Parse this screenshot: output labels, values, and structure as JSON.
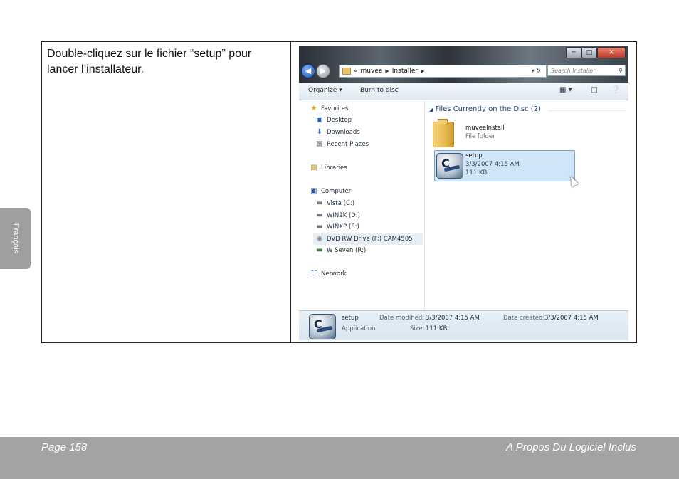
{
  "instruction": "Double-cliquez sur le fichier “setup” pour lancer l’installateur.",
  "side_tab": "Français",
  "footer": {
    "page": "Page 158",
    "section": "A Propos Du Logiciel Inclus"
  },
  "explorer": {
    "address": {
      "prefix": "«",
      "crumbs": [
        "muvee",
        "Installer"
      ]
    },
    "search_placeholder": "Search Installer",
    "toolbar": {
      "organize": "Organize ▾",
      "burn": "Burn to disc"
    },
    "nav": [
      {
        "label": "Favorites",
        "icon": "star-icon"
      },
      {
        "label": "Desktop",
        "icon": "desktop-icon"
      },
      {
        "label": "Downloads",
        "icon": "downloads-icon"
      },
      {
        "label": "Recent Places",
        "icon": "recent-places-icon"
      },
      {
        "label": "Libraries",
        "icon": "libraries-icon"
      },
      {
        "label": "Computer",
        "icon": "computer-icon"
      },
      {
        "label": "Vista (C:)",
        "icon": "drive-icon"
      },
      {
        "label": "WIN2K (D:)",
        "icon": "drive-icon"
      },
      {
        "label": "WINXP (E:)",
        "icon": "drive-icon"
      },
      {
        "label": "DVD RW Drive (F:) CAM4505",
        "icon": "dvd-drive-icon"
      },
      {
        "label": "W Seven (R:)",
        "icon": "drive-icon"
      },
      {
        "label": "Network",
        "icon": "network-icon"
      }
    ],
    "group_header": "Files Currently on the Disc (2)",
    "files": [
      {
        "name": "muveeInstall",
        "type": "File folder"
      },
      {
        "name": "setup",
        "date": "3/3/2007 4:15 AM",
        "size": "111 KB"
      }
    ],
    "details": {
      "name": "setup",
      "type": "Application",
      "modified_label": "Date modified:",
      "modified": "3/3/2007 4:15 AM",
      "created_label": "Date created:",
      "created": "3/3/2007 4:15 AM",
      "size_label": "Size:",
      "size": "111 KB"
    }
  }
}
